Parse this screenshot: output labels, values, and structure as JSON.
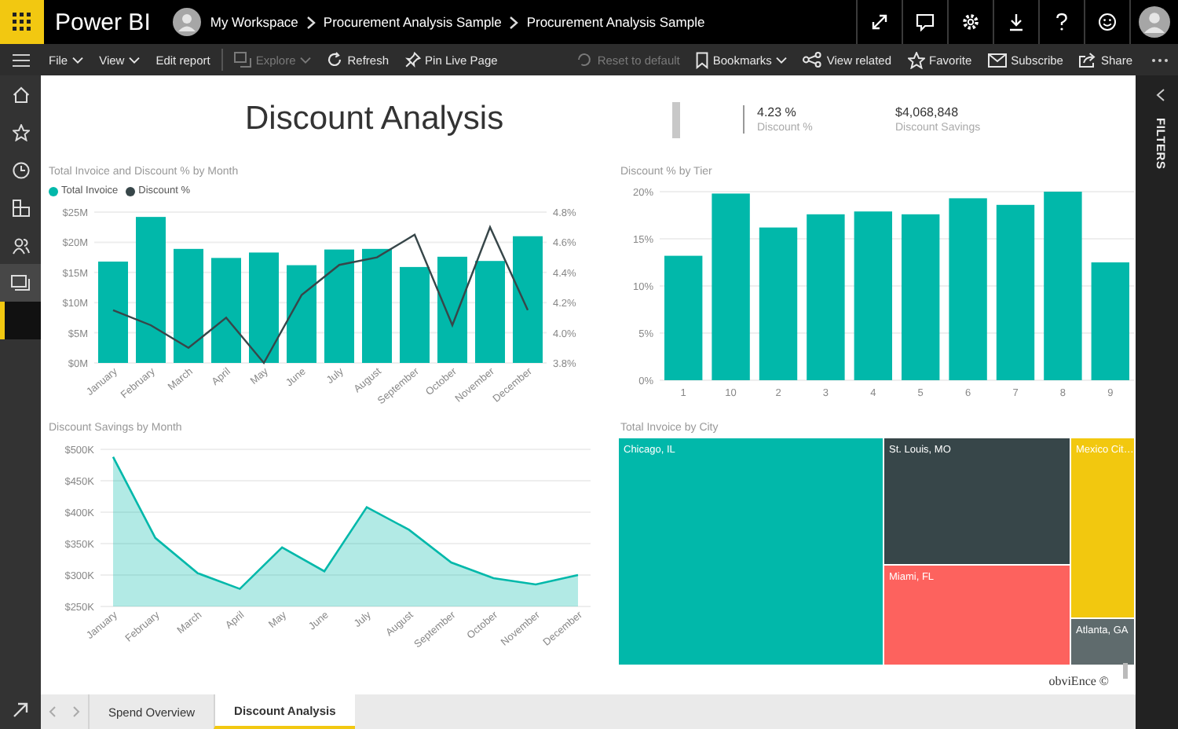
{
  "app": {
    "name": "Power BI"
  },
  "breadcrumb": [
    "My Workspace",
    "Procurement Analysis Sample",
    "Procurement Analysis Sample"
  ],
  "toolbar_left": [
    {
      "label": "File",
      "dropdown": true,
      "disabled": false
    },
    {
      "label": "View",
      "dropdown": true,
      "disabled": false
    },
    {
      "label": "Edit report",
      "dropdown": false,
      "disabled": false
    },
    {
      "label": "Explore",
      "dropdown": true,
      "disabled": true
    },
    {
      "label": "Refresh",
      "dropdown": false,
      "disabled": false
    },
    {
      "label": "Pin Live Page",
      "dropdown": false,
      "disabled": false
    }
  ],
  "toolbar_right": [
    {
      "label": "Reset to default",
      "dropdown": false,
      "disabled": true
    },
    {
      "label": "Bookmarks",
      "dropdown": true,
      "disabled": false
    },
    {
      "label": "View related",
      "dropdown": false,
      "disabled": false
    },
    {
      "label": "Favorite",
      "dropdown": false,
      "disabled": false
    },
    {
      "label": "Subscribe",
      "dropdown": false,
      "disabled": false
    },
    {
      "label": "Share",
      "dropdown": false,
      "disabled": false
    }
  ],
  "nav_rail": [
    {
      "expanded": false,
      "selected": false
    },
    {
      "expanded": false,
      "selected": false
    },
    {
      "expanded": false,
      "selected": false
    },
    {
      "expanded": false,
      "selected": false
    },
    {
      "expanded": false,
      "selected": false
    },
    {
      "expanded": true,
      "selected": false
    },
    {
      "expanded": false,
      "selected": true
    }
  ],
  "report": {
    "title": "Discount Analysis",
    "kpis": [
      {
        "value": "4.23 %",
        "label": "Discount %"
      },
      {
        "value": "$4,068,848",
        "label": "Discount Savings"
      }
    ],
    "combo": {
      "bars": {
        "chart_data": {
          "type": "bar",
          "title": "Total Invoice and Discount % by Month",
          "categories": [
            "January",
            "February",
            "March",
            "April",
            "May",
            "June",
            "July",
            "August",
            "September",
            "October",
            "November",
            "December"
          ],
          "series": [
            {
              "name": "Total Invoice",
              "color": "#01b8aa",
              "values": [
                16.8,
                24.2,
                18.9,
                17.4,
                18.3,
                16.2,
                18.8,
                18.9,
                15.9,
                17.6,
                16.9,
                21.0
              ]
            }
          ],
          "ylim": [
            0,
            25
          ],
          "grid": true,
          "yticks": [
            {
              "value": 0,
              "label": "$0M"
            },
            {
              "value": 5,
              "label": "$5M"
            },
            {
              "value": 10,
              "label": "$10M"
            },
            {
              "value": 15,
              "label": "$15M"
            },
            {
              "value": 20,
              "label": "$20M"
            },
            {
              "value": 25,
              "label": "$25M"
            }
          ]
        }
      },
      "line": {
        "chart_data": {
          "type": "line",
          "series": [
            {
              "name": "Discount %",
              "color": "#374649",
              "values": [
                4.15,
                4.05,
                3.9,
                4.1,
                3.8,
                4.25,
                4.45,
                4.5,
                4.65,
                4.05,
                4.7,
                4.15
              ]
            }
          ],
          "ylim": [
            3.8,
            4.8
          ],
          "yticks": [
            {
              "value": 3.8,
              "label": "3.8%"
            },
            {
              "value": 4.0,
              "label": "4.0%"
            },
            {
              "value": 4.2,
              "label": "4.2%"
            },
            {
              "value": 4.4,
              "label": "4.4%"
            },
            {
              "value": 4.6,
              "label": "4.6%"
            },
            {
              "value": 4.8,
              "label": "4.8%"
            }
          ]
        }
      }
    },
    "tier": {
      "chart_data": {
        "type": "bar",
        "title": "Discount % by Tier",
        "categories": [
          "1",
          "10",
          "2",
          "3",
          "4",
          "5",
          "6",
          "7",
          "8",
          "9"
        ],
        "series": [
          {
            "color": "#01b8aa",
            "values": [
              13.2,
              19.8,
              16.2,
              17.6,
              17.9,
              17.6,
              19.3,
              18.6,
              20.0,
              12.5
            ]
          }
        ],
        "ylim": [
          0,
          20
        ],
        "grid": true,
        "yticks": [
          {
            "value": 0,
            "label": "0%"
          },
          {
            "value": 5,
            "label": "5%"
          },
          {
            "value": 10,
            "label": "10%"
          },
          {
            "value": 15,
            "label": "15%"
          },
          {
            "value": 20,
            "label": "20%"
          }
        ]
      }
    },
    "savings": {
      "chart_data": {
        "type": "area",
        "title": "Discount Savings by Month",
        "categories": [
          "January",
          "February",
          "March",
          "April",
          "May",
          "June",
          "July",
          "August",
          "September",
          "October",
          "November",
          "December"
        ],
        "series": [
          {
            "color": "#01b8aa",
            "values": [
              488,
              359,
              303,
              278,
              344,
              306,
              408,
              372,
              320,
              295,
              285,
              300
            ]
          }
        ],
        "ylim": [
          250,
          500
        ],
        "grid": true,
        "yticks": [
          {
            "value": 250,
            "label": "$250K"
          },
          {
            "value": 300,
            "label": "$300K"
          },
          {
            "value": 350,
            "label": "$350K"
          },
          {
            "value": 400,
            "label": "$400K"
          },
          {
            "value": 450,
            "label": "$450K"
          },
          {
            "value": 500,
            "label": "$500K"
          }
        ]
      }
    },
    "treemap": {
      "title": "Total Invoice by City",
      "cells": [
        {
          "label": "Chicago, IL",
          "color": "#01b8aa"
        },
        {
          "label": "St. Louis, MO",
          "color": "#374649"
        },
        {
          "label": "Miami, FL",
          "color": "#fd625e"
        },
        {
          "label": "Mexico Cit…",
          "color": "#f2c80f"
        },
        {
          "label": "Atlanta, GA",
          "color": "#5f6b6d"
        }
      ]
    },
    "credit": "obviEnce ©"
  },
  "filters_pane": {
    "label": "FILTERS"
  },
  "page_tabs": [
    {
      "label": "Spend Overview",
      "selected": false
    },
    {
      "label": "Discount Analysis",
      "selected": true
    }
  ]
}
